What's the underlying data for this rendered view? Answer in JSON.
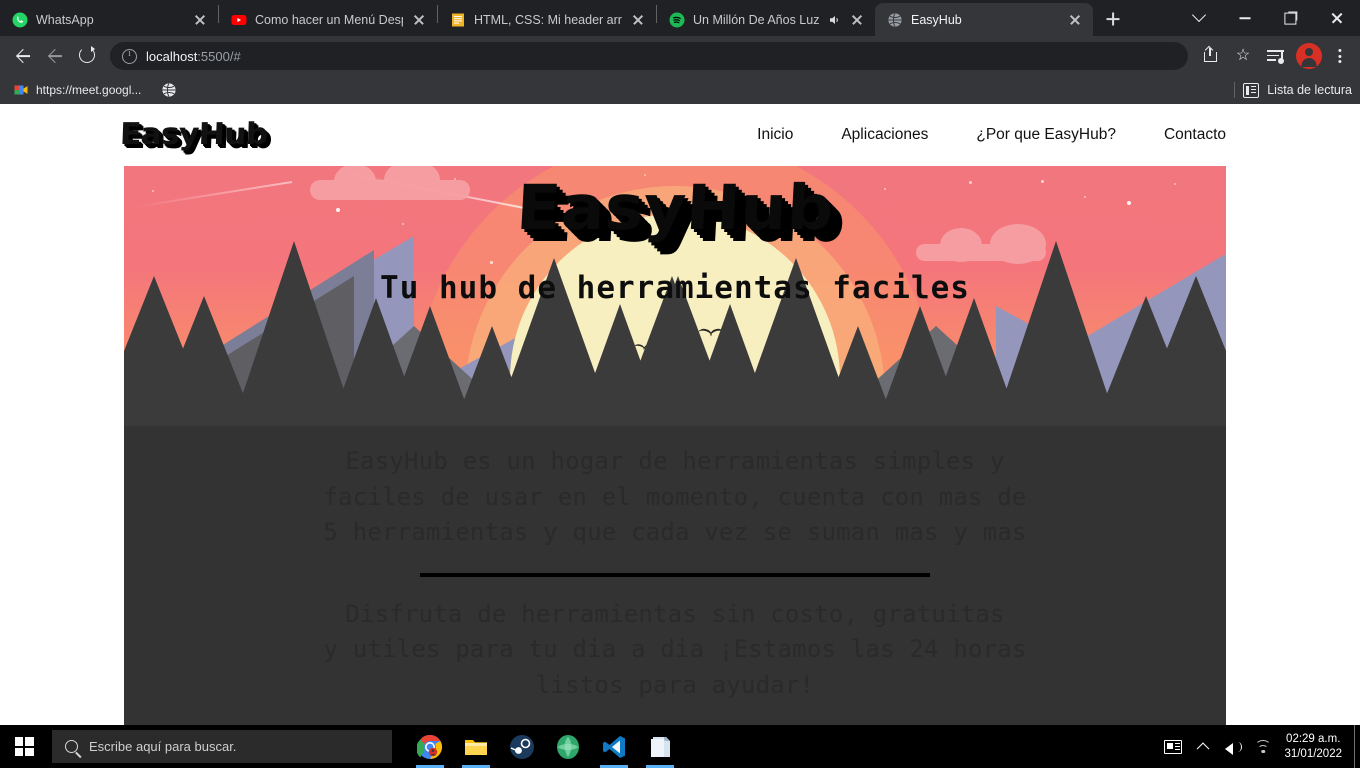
{
  "browser": {
    "tabs": [
      {
        "title": "WhatsApp",
        "icon": "whatsapp-icon",
        "active": false,
        "audio": false
      },
      {
        "title": "Como hacer un Menú Desple",
        "icon": "youtube-icon",
        "active": false,
        "audio": false
      },
      {
        "title": "HTML, CSS: Mi header arruin",
        "icon": "document-icon",
        "active": false,
        "audio": false
      },
      {
        "title": "Un Millón De Años Luz -",
        "icon": "spotify-icon",
        "active": false,
        "audio": true
      },
      {
        "title": "EasyHub",
        "icon": "globe-icon",
        "active": true,
        "audio": false
      }
    ],
    "new_tab_label": "+",
    "window_controls": [
      "chevron-down-icon",
      "minimize-icon",
      "maximize-icon",
      "close-icon"
    ],
    "omnibox": {
      "url_host": "localhost",
      "url_rest": ":5500/#",
      "info_icon": "info-icon"
    },
    "toolbar_icons": [
      "back-icon",
      "forward-icon",
      "reload-icon",
      "share-icon",
      "star-icon",
      "media-control-icon",
      "avatar-icon",
      "kebab-menu-icon"
    ],
    "bookmarks": [
      {
        "label": "https://meet.googl...",
        "icon": "meet-icon"
      },
      {
        "label": "",
        "icon": "globe-icon"
      }
    ],
    "reading_list_label": "Lista de lectura"
  },
  "site": {
    "logo": "EasyHub",
    "nav": [
      {
        "label": "Inicio"
      },
      {
        "label": "Aplicaciones"
      },
      {
        "label": "¿Por que EasyHub?"
      },
      {
        "label": "Contacto"
      }
    ],
    "hero": {
      "title": "EasyHub",
      "subtitle": "Tu hub de herramientas faciles"
    },
    "paragraph_1": "EasyHub es un hogar de herramientas simples y\nfaciles de usar en el momento, cuenta con mas de\n5 herramientas y que cada vez se suman mas y mas",
    "paragraph_2": "Disfruta de herramientas sin costo, gratuitas\ny utiles para tu dia a dia ¡Estamos las 24 horas\nlistos para ayudar!",
    "colors": {
      "sky_top": "#f2767e",
      "sky_bottom": "#f99a66",
      "sun": "#f7efbf",
      "mountain_near": "#3b3b3b",
      "mountain_far": "#8c8fb3",
      "page_bg": "#333333",
      "text": "#2a2a2a"
    }
  },
  "taskbar": {
    "start_label": "start-button",
    "search_placeholder": "Escribe aquí para buscar.",
    "apps": [
      {
        "name": "chrome",
        "running": true
      },
      {
        "name": "file-explorer",
        "running": true
      },
      {
        "name": "steam",
        "running": false
      },
      {
        "name": "green-app",
        "running": false
      },
      {
        "name": "vscode",
        "running": true
      },
      {
        "name": "sticky-notes",
        "running": true
      }
    ],
    "tray_icons": [
      "news-icon",
      "show-hidden-icons-icon",
      "volume-icon",
      "wifi-icon"
    ],
    "time": "02:29 a.m.",
    "date": "31/01/2022"
  }
}
